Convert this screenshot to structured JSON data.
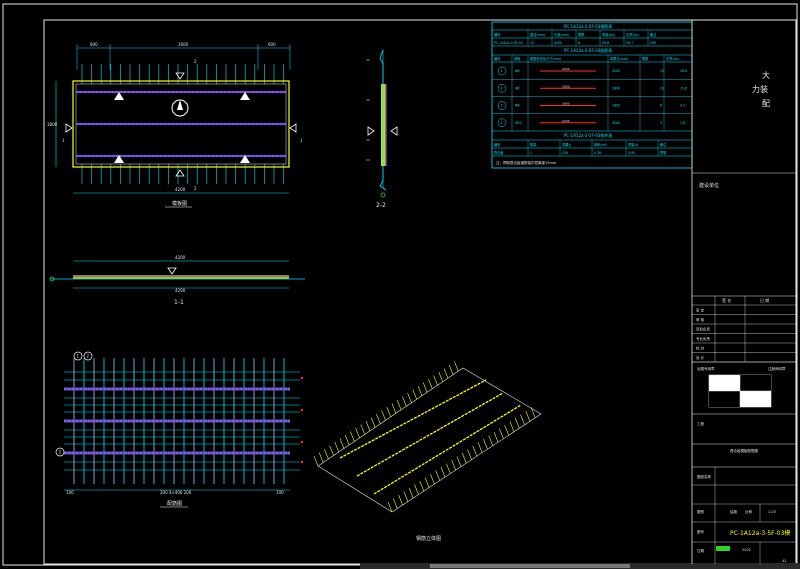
{
  "colors": {
    "background": "#000000",
    "frame": "#e6e6e6",
    "cyan": "#00e5ff",
    "yellow": "#ffff00",
    "purple": "#6b4bd6",
    "green": "#2bd42b",
    "red": "#ff3030",
    "white": "#ffffff"
  },
  "plan_view": {
    "title": "模板图",
    "dim_top_left": "600",
    "dim_top_mid": "2600",
    "dim_top_right": "600",
    "dim_bottom": "4200",
    "dim_left": "1800",
    "section_mark_top": "2",
    "section_mark_bottom": "2",
    "section_mark_left": "1",
    "section_mark_right": "1"
  },
  "section_2": {
    "title": "2-2"
  },
  "section_1": {
    "title": "1-1",
    "dim_top": "4200",
    "dim_bottom": "4200"
  },
  "rebar_view": {
    "title": "配筋图",
    "dim_bottom": "200 4×400 200",
    "dim_bottom_left": "100",
    "dim_bottom_right": "100",
    "bubble_1": "1",
    "bubble_2": "2",
    "bubble_3": "3"
  },
  "iso_view": {
    "title": "钢筋立体图"
  },
  "table_1": {
    "title": "PC-1A12a-3-5F-03钢筋表",
    "headers": [
      "编号",
      "直径(mm)",
      "长度(mm)",
      "根数",
      "重量(kg)",
      "总重(kg)",
      "备注"
    ],
    "row": [
      "PC-1A12a-3-5F-03",
      "12",
      "4200",
      "8",
      "29.8",
      "59.7",
      "C30"
    ]
  },
  "table_2": {
    "title": "PC-1A12a-3-5F-03配筋表",
    "headers": [
      "编号",
      "规格",
      "钢筋形状及尺寸(mm)",
      "单根长(mm)",
      "根数",
      "总重(kg)"
    ],
    "rows": [
      {
        "id": "1",
        "spec": "Φ8",
        "len": "4200",
        "count": "10",
        "weight": "16.6",
        "shape": "4200"
      },
      {
        "id": "2",
        "spec": "Φ8",
        "len": "1800",
        "count": "22",
        "weight": "15.6",
        "shape": "1800"
      },
      {
        "id": "3",
        "spec": "Φ8",
        "len": "1800",
        "count": "6",
        "weight": "4.3",
        "shape": "1800"
      },
      {
        "id": "4",
        "spec": "Φ10",
        "len": "4200",
        "count": "3",
        "weight": "7.8",
        "shape": "4200"
      }
    ]
  },
  "table_3": {
    "title": "PC-1A12a-3-5F-03构件表",
    "headers": [
      "编号",
      "数量",
      "混凝土",
      "体积(m³)",
      "重量(t)",
      "备注"
    ],
    "row": [
      "叠合板",
      "1",
      "C30",
      "0.38",
      "0.95",
      "预制"
    ]
  },
  "table_note": "注：预制叠合板钢筋保护层厚度15mm",
  "title_block": {
    "company_line1": "大",
    "company_line2": "力装",
    "company_line3": "配",
    "project_label": "建设单位",
    "header_left": "签 名",
    "header_right": "日 期",
    "rows": [
      "审 定",
      "审 核",
      "项目负责",
      "专业负责",
      "校 对",
      "设 计"
    ],
    "stamp_label": "出图专用章",
    "stamp_value": "注册师印章",
    "project_name_label": "工程",
    "drawing_name": "叠合板模板配筋图",
    "drawing_title_label": "图纸名称",
    "scale_label": "比例",
    "scale_value": "1:25",
    "drawing_no_label": "图号",
    "drawing_no": "PC-1A12a-3-5F-03模",
    "date_label": "日期",
    "date_value": "2022",
    "sheet_label": "图别",
    "sheet_value": "结施",
    "page": "42"
  }
}
